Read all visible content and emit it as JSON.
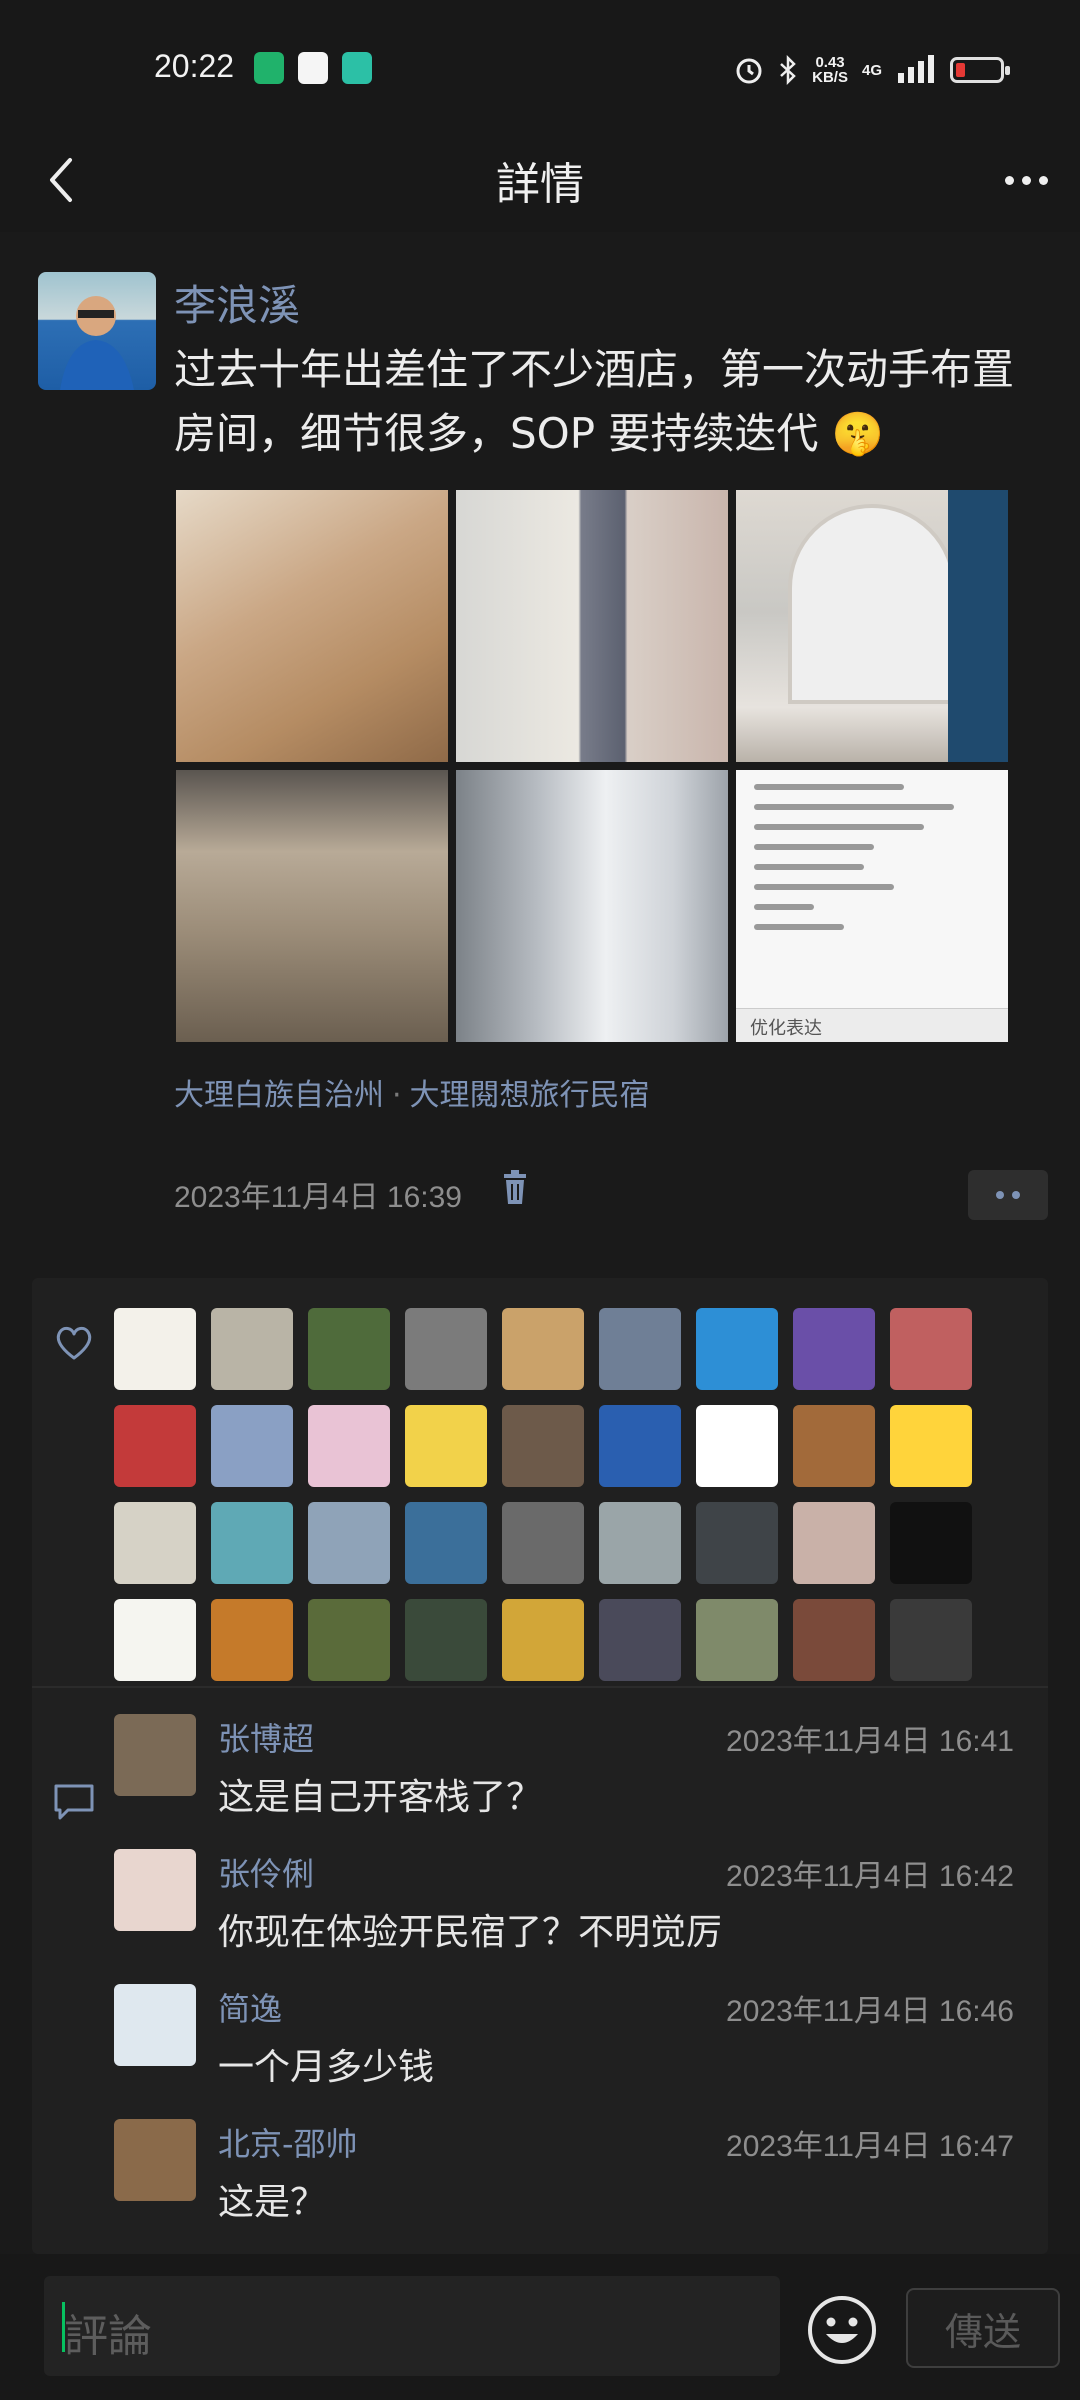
{
  "status_bar": {
    "time": "20:22",
    "net_speed_value": "0.43",
    "net_speed_unit": "KB/S",
    "network": "4G"
  },
  "nav": {
    "title": "詳情"
  },
  "post": {
    "author": "李浪溪",
    "text": "过去十年出差住了不少酒店，第一次动手布置房间，细节很多，SOP 要持续迭代 🤫",
    "location_city": "大理白族自治州",
    "location_separator": "·",
    "location_place": "大理閱想旅行民宿",
    "timestamp": "2023年11月4日 16:39",
    "doc_image_footer": "优化表达"
  },
  "likes": {
    "avatar_colors": [
      "#f3f1ea",
      "#b9b4a6",
      "#4f6b3b",
      "#7b7b7b",
      "#caa26a",
      "#6f7f96",
      "#2d8fd6",
      "#6a4fa8",
      "#c06060",
      "#c33a3a",
      "#8aa0c4",
      "#e9c3d5",
      "#f2d24a",
      "#6d5a4a",
      "#2a5fb0",
      "#ffffff",
      "#a26a3a",
      "#ffd43b",
      "#d6d2c6",
      "#5fa9b5",
      "#8fa3b8",
      "#3b6f9a",
      "#6a6a6a",
      "#9aa5a8",
      "#3f4448",
      "#c9b1a8",
      "#111111",
      "#f5f5f0",
      "#c57a2a",
      "#5a6b3a",
      "#3a4a3a",
      "#d2a638",
      "#4a4a5a",
      "#7f8a6a",
      "#7a4a3a",
      "#3a3a3a"
    ]
  },
  "comments": [
    {
      "name": "张博超",
      "time": "2023年11月4日 16:41",
      "text": "这是自己开客栈了？",
      "avatar_color": "#7b6a56"
    },
    {
      "name": "张伶俐",
      "time": "2023年11月4日 16:42",
      "text": "你现在体验开民宿了？不明觉厉",
      "avatar_color": "#e8d6cf"
    },
    {
      "name": "简逸",
      "time": "2023年11月4日 16:46",
      "text": "一个月多少钱",
      "avatar_color": "#dfe8ef"
    },
    {
      "name": "北京-邵帅",
      "time": "2023年11月4日 16:47",
      "text": "这是？",
      "avatar_color": "#8a6a4a"
    }
  ],
  "input": {
    "placeholder": "評論",
    "send_label": "傳送"
  },
  "colors": {
    "link": "#7e93b6",
    "background": "#181818",
    "accent_caret": "#07c160"
  }
}
